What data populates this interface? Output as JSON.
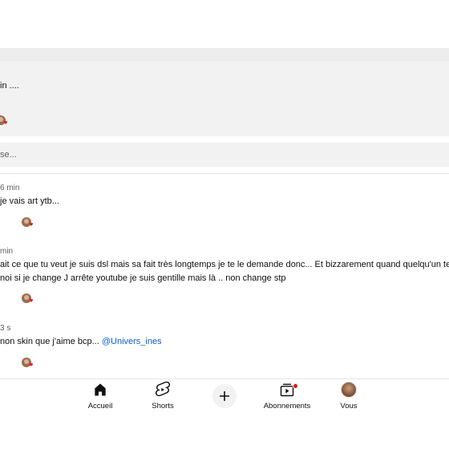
{
  "pinned": {
    "text": "in ...."
  },
  "reply_input": {
    "placeholder": "se..."
  },
  "comments": [
    {
      "meta": "6 min",
      "text": "je vais art ytb..."
    },
    {
      "meta": "min",
      "text_line1": "ait ce que tu veut je suis dsl mais sa fait très longtemps je te le demande donc... Et bizzarement quand quelqu'un te",
      "text_line2": "noi si je change J arrête youtube je suis gentille mais là .. non change stp"
    },
    {
      "meta": "3 s",
      "text": "non skin que j'aime bcp... ",
      "mention": "@Univers_ines"
    }
  ],
  "nav": {
    "items": [
      {
        "label": "Accueil",
        "icon": "home-icon"
      },
      {
        "label": "Shorts",
        "icon": "shorts-icon"
      },
      {
        "label": "",
        "icon": "plus-icon"
      },
      {
        "label": "Abonnements",
        "icon": "subscriptions-icon"
      },
      {
        "label": "Vous",
        "icon": "profile-avatar-icon"
      }
    ]
  },
  "colors": {
    "panel_bg": "#f2f2f2",
    "mention": "#065fd4",
    "heart": "#ff0000",
    "notification_dot": "#ff0000"
  }
}
